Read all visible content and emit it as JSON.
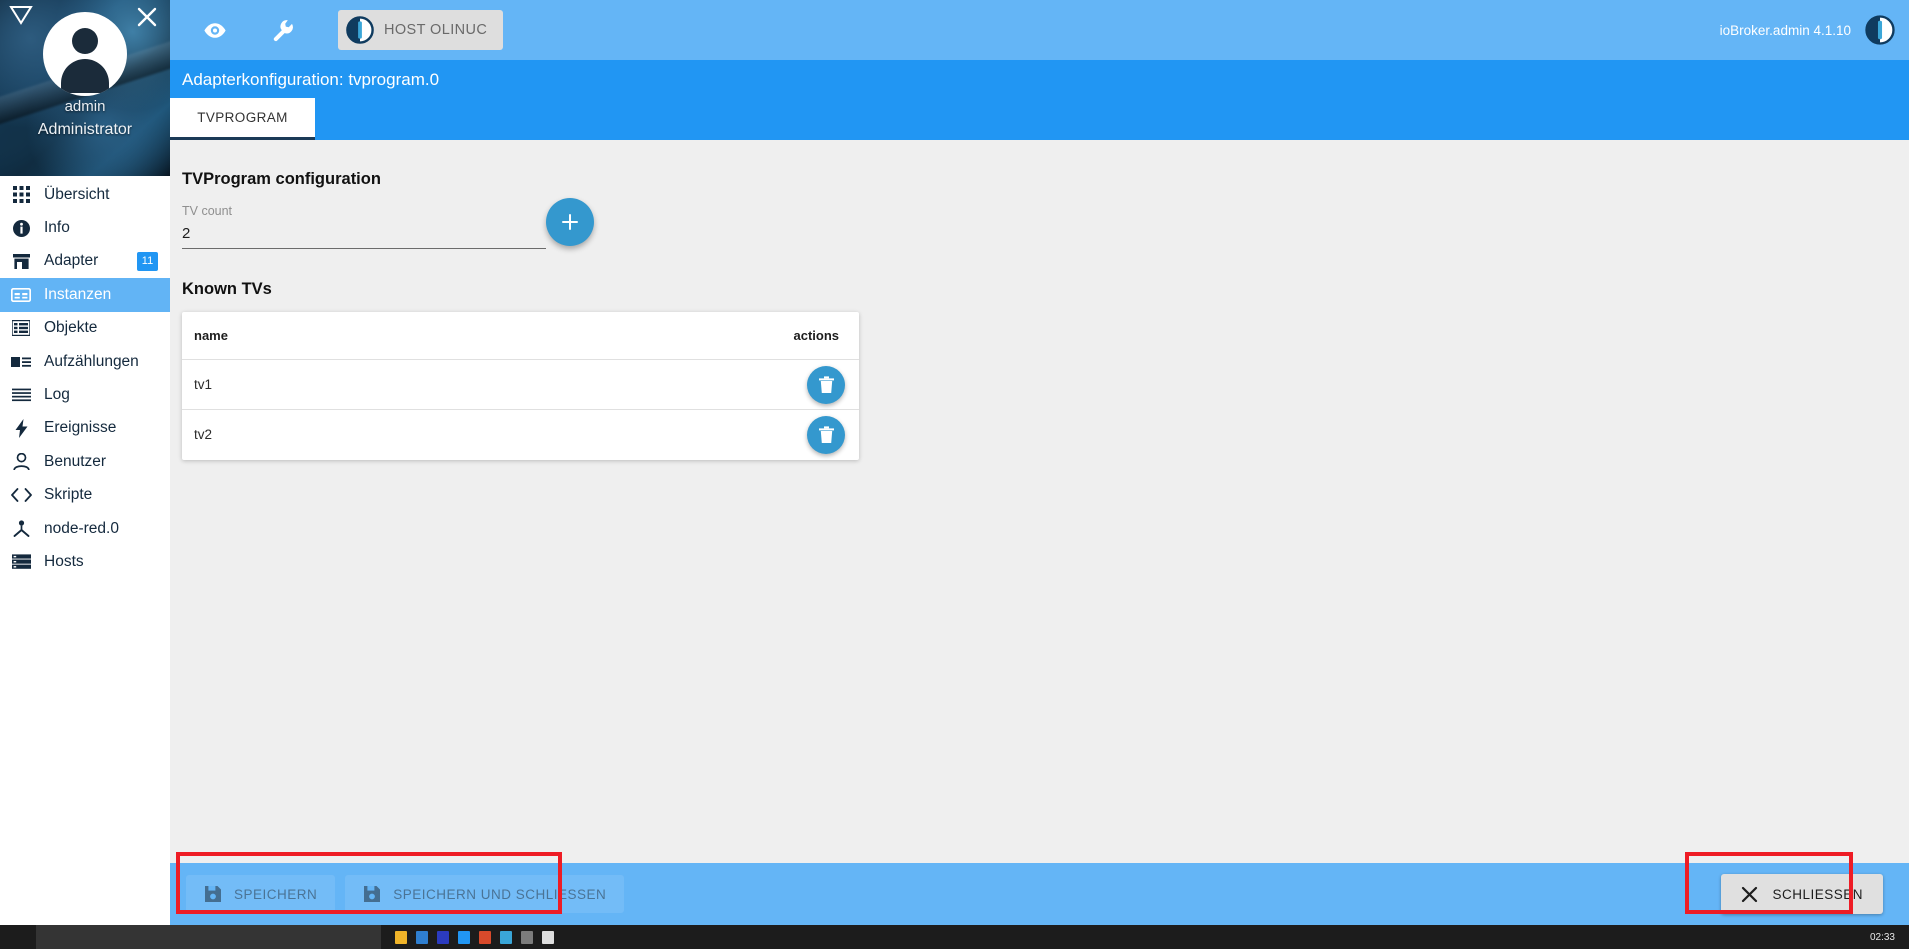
{
  "sidebar": {
    "logo_icon": "iobroker-triangle-icon",
    "close_icon": "close-icon",
    "avatar_icon": "avatar",
    "user_name": "admin",
    "user_role": "Administrator",
    "items": [
      {
        "label": "Übersicht",
        "icon": "grid-icon",
        "badge": "",
        "selected": false
      },
      {
        "label": "Info",
        "icon": "info-icon",
        "badge": "",
        "selected": false
      },
      {
        "label": "Adapter",
        "icon": "store-icon",
        "badge": "11",
        "selected": false
      },
      {
        "label": "Instanzen",
        "icon": "instances-icon",
        "badge": "",
        "selected": true
      },
      {
        "label": "Objekte",
        "icon": "list-icon",
        "badge": "",
        "selected": false
      },
      {
        "label": "Aufzählungen",
        "icon": "enum-icon",
        "badge": "",
        "selected": false
      },
      {
        "label": "Log",
        "icon": "log-lines-icon",
        "badge": "",
        "selected": false
      },
      {
        "label": "Ereignisse",
        "icon": "bolt-icon",
        "badge": "",
        "selected": false
      },
      {
        "label": "Benutzer",
        "icon": "person-icon",
        "badge": "",
        "selected": false
      },
      {
        "label": "Skripte",
        "icon": "code-icon",
        "badge": "",
        "selected": false
      },
      {
        "label": "node-red.0",
        "icon": "node-red-icon",
        "badge": "",
        "selected": false
      },
      {
        "label": "Hosts",
        "icon": "hosts-icon",
        "badge": "",
        "selected": false
      }
    ]
  },
  "toolbar": {
    "eye_icon": "eye-icon",
    "wrench_icon": "wrench-icon",
    "host_chip_icon": "iobroker-logo-icon",
    "host_chip_label": "HOST OLINUC",
    "admin_version": "ioBroker.admin 4.1.10",
    "right_logo_icon": "iobroker-logo-icon"
  },
  "config": {
    "title": "Adapterkonfiguration: tvprogram.0",
    "tabs": [
      {
        "label": "TVPROGRAM",
        "selected": true
      }
    ],
    "section_title": "TVProgram configuration",
    "count_label": "TV count",
    "count_value": "2",
    "count_placeholder": "",
    "add_icon": "plus-icon",
    "table_title": "Known TVs",
    "columns": [
      "name",
      "actions"
    ],
    "rows": [
      {
        "name": "tv1",
        "action_icon": "trash-icon"
      },
      {
        "name": "tv2",
        "action_icon": "trash-icon"
      }
    ]
  },
  "footer": {
    "save_label": "SPEICHERN",
    "save_icon": "save-icon",
    "save_close_label": "SPEICHERN UND SCHLIESSEN",
    "save_close_icon": "save-icon",
    "close_label": "SCHLIESSEN",
    "close_icon": "close-x-icon"
  },
  "annotations": {
    "box_color": "#ee1c25",
    "save_box": "save-buttons-highlight",
    "close_box": "close-button-highlight"
  },
  "taskbar": {
    "clock": "02:33"
  },
  "colors": {
    "accent": "#2196f3",
    "toolbar": "#64b5f6",
    "fab": "#3498ce",
    "selected_nav": "#62b4f5",
    "annotation": "#ee1c25"
  }
}
